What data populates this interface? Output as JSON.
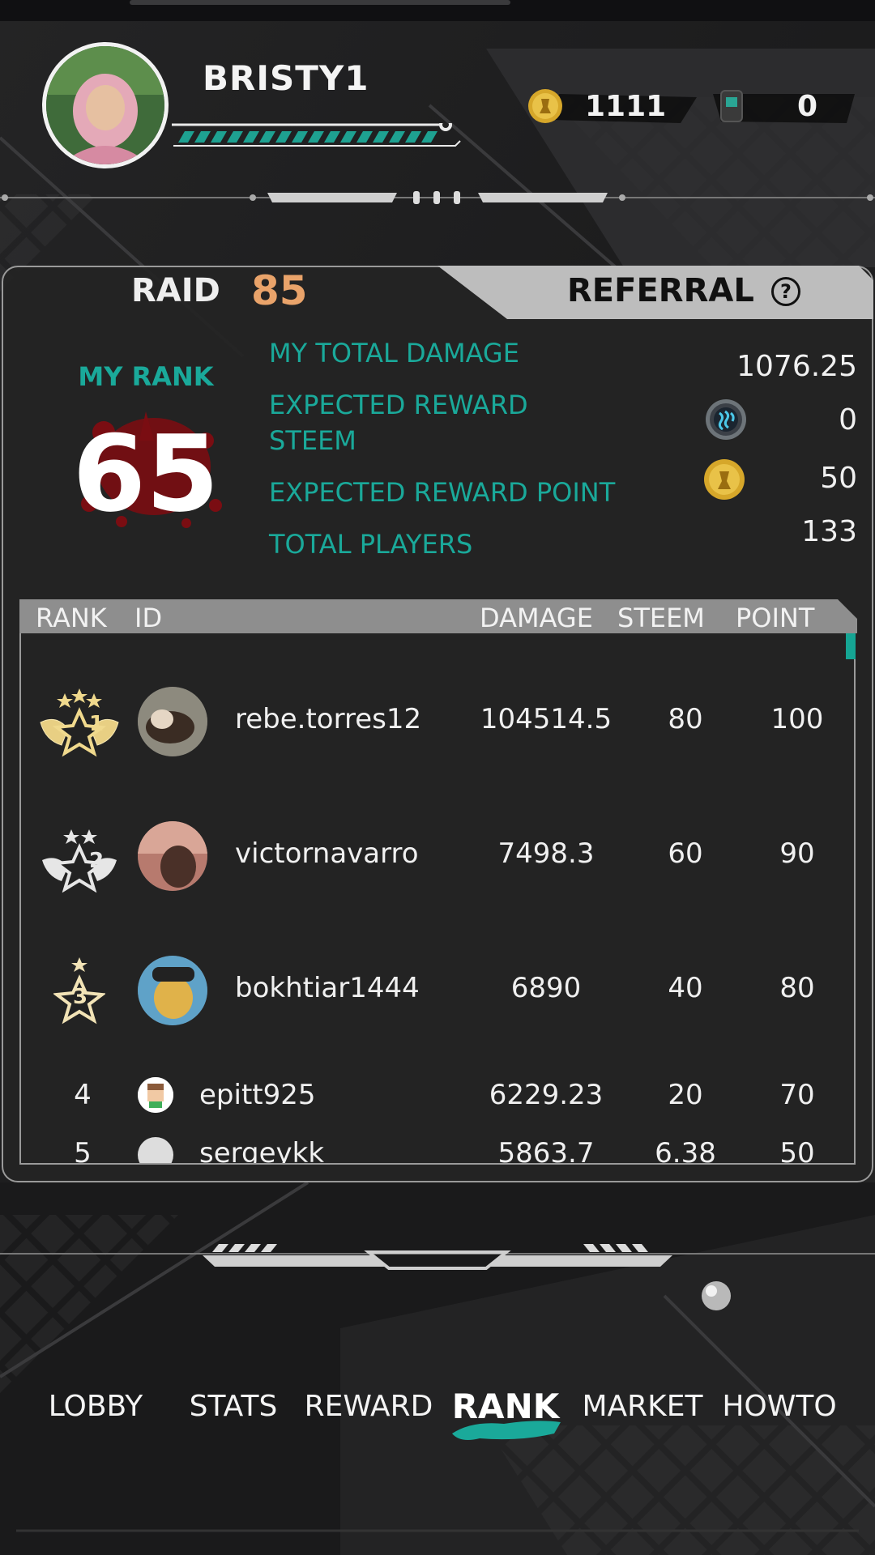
{
  "header": {
    "username": "BRISTY1",
    "coins": "1111",
    "tickets": "0"
  },
  "panel": {
    "tabs": {
      "raid_label": "RAID",
      "raid_number": "85",
      "referral_label": "REFERRAL",
      "help": "?"
    },
    "my_rank": {
      "label": "MY RANK",
      "value": "65"
    },
    "stats": [
      {
        "label_line1": "MY TOTAL DAMAGE",
        "label_line2": "",
        "value": "1076.25",
        "icon": ""
      },
      {
        "label_line1": "EXPECTED REWARD",
        "label_line2": "STEEM",
        "value": "0",
        "icon": "steem-icon"
      },
      {
        "label_line1": "EXPECTED REWARD POINT",
        "label_line2": "",
        "value": "50",
        "icon": "coin-icon"
      },
      {
        "label_line1": "TOTAL PLAYERS",
        "label_line2": "",
        "value": "133",
        "icon": ""
      }
    ]
  },
  "table": {
    "headers": {
      "rank": "RANK",
      "id": "ID",
      "damage": "DAMAGE",
      "steem": "STEEM",
      "point": "POINT"
    },
    "rows": [
      {
        "rank": "1",
        "id": "rebe.torres12",
        "damage": "104514.5",
        "steem": "80",
        "point": "100"
      },
      {
        "rank": "2",
        "id": "victornavarro",
        "damage": "7498.3",
        "steem": "60",
        "point": "90"
      },
      {
        "rank": "3",
        "id": "bokhtiar1444",
        "damage": "6890",
        "steem": "40",
        "point": "80"
      },
      {
        "rank": "4",
        "id": "epitt925",
        "damage": "6229.23",
        "steem": "20",
        "point": "70"
      },
      {
        "rank": "5",
        "id": "sergeykk",
        "damage": "5863.7",
        "steem": "6.38",
        "point": "50"
      }
    ]
  },
  "nav": {
    "items": [
      "LOBBY",
      "STATS",
      "REWARD",
      "RANK",
      "MARKET",
      "HOWTO"
    ],
    "active": "RANK"
  },
  "colors": {
    "accent": "#1aa99a",
    "raid_number": "#e9a36a",
    "rank_red": "#7a0d12"
  }
}
